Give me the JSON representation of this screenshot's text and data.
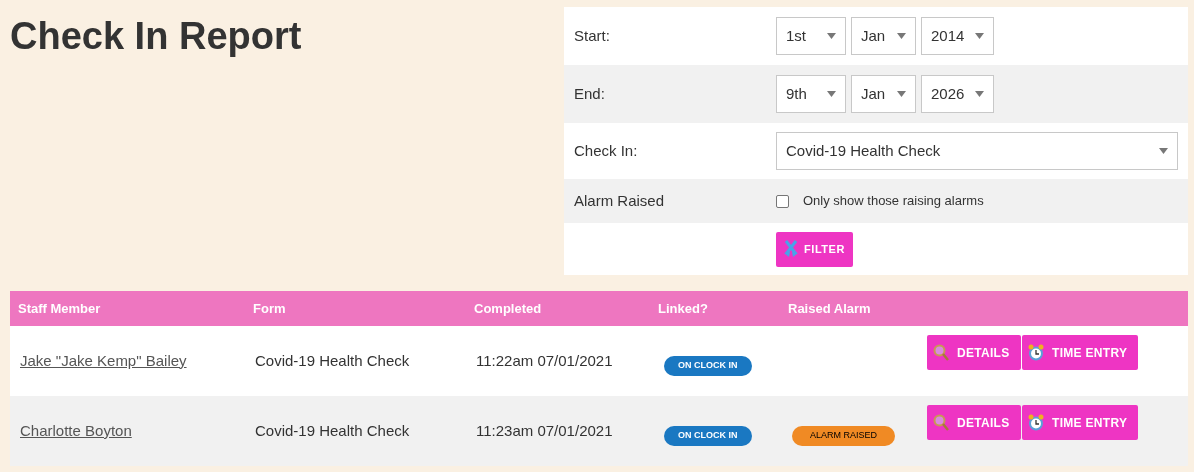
{
  "title": "Check In Report",
  "filter": {
    "start": {
      "label": "Start:",
      "day": "1st",
      "month": "Jan",
      "year": "2014"
    },
    "end": {
      "label": "End:",
      "day": "9th",
      "month": "Jan",
      "year": "2026"
    },
    "check_in": {
      "label": "Check In:",
      "value": "Covid-19 Health Check"
    },
    "alarm": {
      "label": "Alarm Raised",
      "option": "Only show those raising alarms",
      "checked": false
    },
    "button": "FILTER"
  },
  "table": {
    "columns": [
      "Staff Member",
      "Form",
      "Completed",
      "Linked?",
      "Raised Alarm"
    ],
    "rows": [
      {
        "staff": "Jake \"Jake Kemp\" Bailey",
        "form": "Covid-19 Health Check",
        "completed": "11:22am 07/01/2021",
        "linked": "ON CLOCK IN",
        "actions": [
          "DETAILS",
          "TIME ENTRY"
        ]
      },
      {
        "staff": "Charlotte Boyton",
        "form": "Covid-19 Health Check",
        "completed": "11:23am 07/01/2021",
        "linked": "ON CLOCK IN",
        "alarm": "ALARM RAISED",
        "actions": [
          "DETAILS",
          "TIME ENTRY"
        ]
      }
    ]
  }
}
